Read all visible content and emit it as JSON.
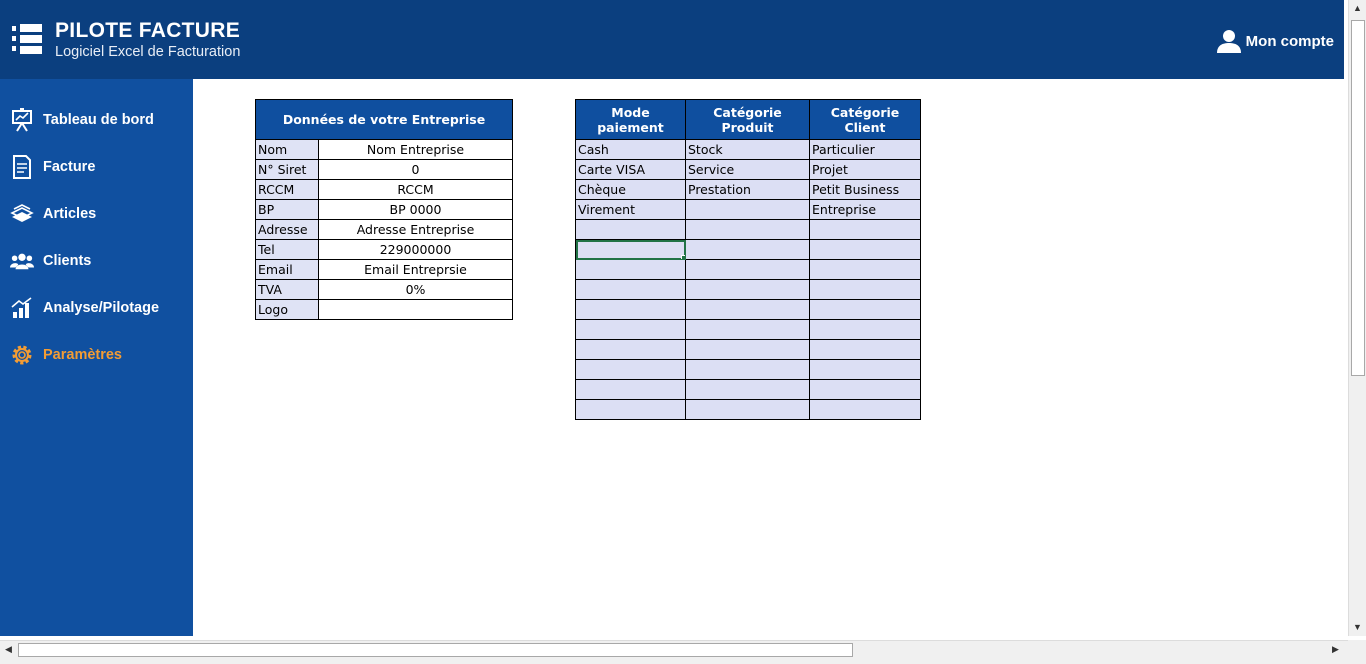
{
  "header": {
    "title": "PILOTE FACTURE",
    "subtitle": "Logiciel Excel de Facturation",
    "account_label": "Mon compte"
  },
  "sidebar": {
    "items": [
      {
        "label": "Tableau de bord",
        "icon": "presentation-board-icon"
      },
      {
        "label": "Facture",
        "icon": "invoice-icon"
      },
      {
        "label": "Articles",
        "icon": "stack-books-icon"
      },
      {
        "label": "Clients",
        "icon": "users-group-icon"
      },
      {
        "label": "Analyse/Pilotage",
        "icon": "bar-chart-icon"
      },
      {
        "label": "Paramètres",
        "icon": "gear-icon",
        "active": true
      }
    ]
  },
  "company": {
    "header": "Données de votre Entreprise",
    "rows": [
      {
        "label": "Nom",
        "value": "Nom Entreprise"
      },
      {
        "label": "N° Siret",
        "value": "0"
      },
      {
        "label": "RCCM",
        "value": "RCCM"
      },
      {
        "label": "BP",
        "value": "BP 0000"
      },
      {
        "label": "Adresse",
        "value": "Adresse Entreprise"
      },
      {
        "label": "Tel",
        "value": "229000000"
      },
      {
        "label": "Email",
        "value": "Email Entreprsie"
      },
      {
        "label": "TVA",
        "value": "0%"
      },
      {
        "label": "Logo",
        "value": ""
      }
    ]
  },
  "lists": {
    "headers": [
      "Mode paiement",
      "Catégorie Produit",
      "Catégorie Client"
    ],
    "rows": [
      [
        "Cash",
        "Stock",
        "Particulier"
      ],
      [
        "Carte VISA",
        "Service",
        "Projet"
      ],
      [
        "Chèque",
        "Prestation",
        "Petit Business"
      ],
      [
        "Virement",
        "",
        "Entreprise"
      ],
      [
        "",
        "",
        ""
      ],
      [
        "",
        "",
        ""
      ],
      [
        "",
        "",
        ""
      ],
      [
        "",
        "",
        ""
      ],
      [
        "",
        "",
        ""
      ],
      [
        "",
        "",
        ""
      ],
      [
        "",
        "",
        ""
      ],
      [
        "",
        "",
        ""
      ],
      [
        "",
        "",
        ""
      ],
      [
        "",
        "",
        ""
      ]
    ]
  },
  "colors": {
    "header_bg": "#0b3f7f",
    "sidebar_bg": "#1050a0",
    "active_item": "#f39c34",
    "table_header_bg": "#0f4f9f",
    "cell_fill": "#dcdff4",
    "selection": "#217346"
  }
}
